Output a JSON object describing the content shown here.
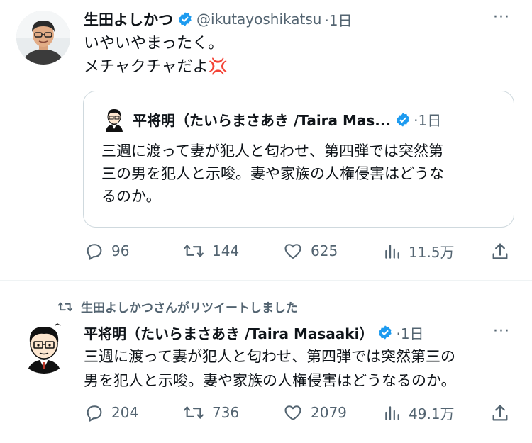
{
  "tweet1": {
    "author_name": "生田よしかつ",
    "handle": "@ikutayoshikatsu",
    "time": "·1日",
    "more": "···",
    "lines": [
      "いやいやまったく。",
      "メチャクチャだよ💢"
    ],
    "quote": {
      "author_name": "平将明（たいらまさあき /Taira Mas...",
      "time": "·1日",
      "lines": [
        "三週に渡って妻が犯人と匂わせ、第四弾では突然第",
        "三の男を犯人と示唆。妻や家族の人権侵害はどうな",
        "るのか。"
      ]
    },
    "actions": {
      "replies": "96",
      "retweets": "144",
      "likes": "625",
      "views": "11.5万"
    }
  },
  "tweet2": {
    "retweet_banner": "生田よしかつさんがリツイートしました",
    "author_name": "平将明（たいらまさあき /Taira Masaaki）",
    "time": "·1日",
    "more": "···",
    "lines": [
      "三週に渡って妻が犯人と匂わせ、第四弾では突然第三の",
      "男を犯人と示唆。妻や家族の人権侵害はどうなるのか。"
    ],
    "actions": {
      "replies": "204",
      "retweets": "736",
      "likes": "2079",
      "views": "49.1万"
    }
  },
  "colors": {
    "verified": "#1d9bf0",
    "secondary_text": "#536471",
    "border": "#cfd9de"
  },
  "icons": [
    "verified-badge-icon",
    "reply-icon",
    "retweet-icon",
    "like-icon",
    "views-icon",
    "share-icon",
    "more-icon"
  ]
}
